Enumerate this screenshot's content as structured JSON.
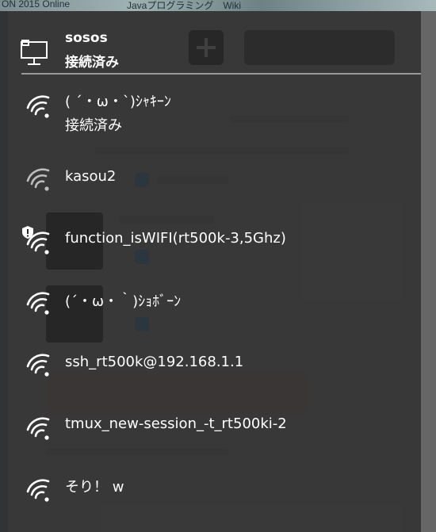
{
  "background": {
    "tab_text_left": "ON 2015 Online",
    "tab_text_right": "Javaプログラミング　Wiki"
  },
  "connected": {
    "ssid": "sosos",
    "status": "接続済み",
    "icon": "wired-network-icon"
  },
  "networks": [
    {
      "ssid": "( ´・ω・`)ｼｬｷｰﾝ",
      "status": "接続済み",
      "icon": "wifi-icon",
      "secured_warning": false
    },
    {
      "ssid": "kasou2",
      "status": "",
      "icon": "wifi-weak-icon",
      "secured_warning": false
    },
    {
      "ssid": "function_isWIFI(rt500k-3,5Ghz)",
      "status": "",
      "icon": "wifi-icon",
      "secured_warning": true
    },
    {
      "ssid": "(´・ω・｀)ｼｮﾎﾞｰﾝ",
      "status": "",
      "icon": "wifi-icon",
      "secured_warning": false
    },
    {
      "ssid": "ssh_rt500k@192.168.1.1",
      "status": "",
      "icon": "wifi-icon",
      "secured_warning": false
    },
    {
      "ssid": "tmux_new-session_-t_rt500ki-2",
      "status": "",
      "icon": "wifi-icon",
      "secured_warning": false
    },
    {
      "ssid": "そり！ w",
      "status": "",
      "icon": "wifi-icon",
      "secured_warning": false
    }
  ],
  "colors": {
    "text": "#ffffff",
    "icon": "#ffffff",
    "icon_weak": "#bdbdbd",
    "divider": "#9a9a9a"
  }
}
